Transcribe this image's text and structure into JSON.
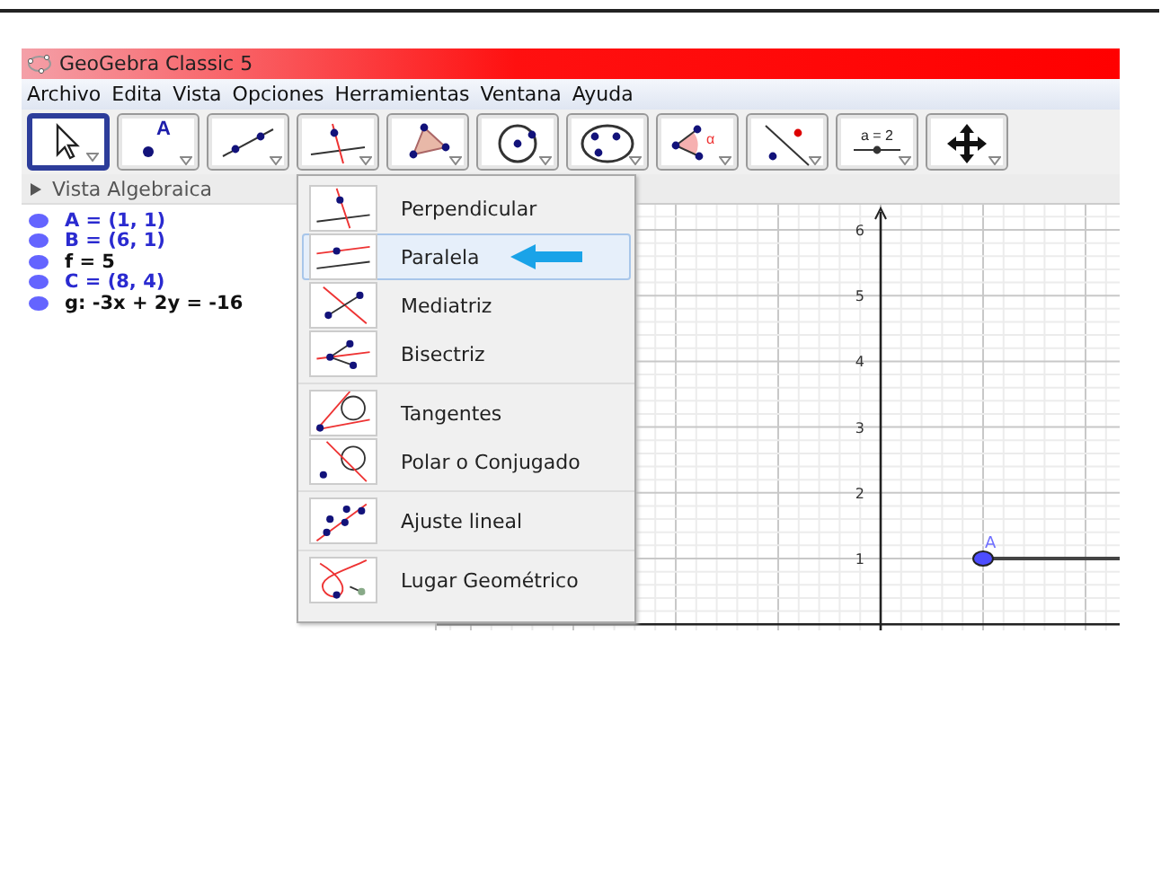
{
  "window": {
    "title": "GeoGebra Classic 5"
  },
  "menu": [
    "Archivo",
    "Edita",
    "Vista",
    "Opciones",
    "Herramientas",
    "Ventana",
    "Ayuda"
  ],
  "toolbar": [
    {
      "kind": "move",
      "selected": true
    },
    {
      "kind": "point",
      "selected": false,
      "caption": "A"
    },
    {
      "kind": "line",
      "selected": false
    },
    {
      "kind": "perpendicular",
      "selected": false
    },
    {
      "kind": "polygon",
      "selected": false
    },
    {
      "kind": "circle",
      "selected": false
    },
    {
      "kind": "conic",
      "selected": false
    },
    {
      "kind": "angle",
      "selected": false,
      "caption": "α"
    },
    {
      "kind": "reflect",
      "selected": false
    },
    {
      "kind": "slider",
      "selected": false,
      "caption": "a = 2"
    },
    {
      "kind": "move_view",
      "selected": false
    }
  ],
  "algebra_view": {
    "title": "Vista Algebraica",
    "items": [
      {
        "text": "A = (1, 1)",
        "kind": "free"
      },
      {
        "text": "B = (6, 1)",
        "kind": "free"
      },
      {
        "text": "f = 5",
        "kind": "dependent"
      },
      {
        "text": "C = (8, 4)",
        "kind": "free"
      },
      {
        "text": "g: -3x + 2y = -16",
        "kind": "dependent"
      }
    ]
  },
  "tool_menu": {
    "groups": [
      {
        "items": [
          {
            "label": "Perpendicular",
            "kind": "perpendicular",
            "selected": false
          },
          {
            "label": "Paralela",
            "kind": "parallel",
            "selected": true
          },
          {
            "label": "Mediatriz",
            "kind": "bisector",
            "selected": false
          },
          {
            "label": "Bisectriz",
            "kind": "angle_bisector",
            "selected": false
          }
        ]
      },
      {
        "items": [
          {
            "label": "Tangentes",
            "kind": "tangents",
            "selected": false
          },
          {
            "label": "Polar o Conjugado",
            "kind": "polar",
            "selected": false
          }
        ]
      },
      {
        "items": [
          {
            "label": "Ajuste lineal",
            "kind": "best_fit",
            "selected": false
          }
        ]
      },
      {
        "items": [
          {
            "label": "Lugar Geométrico",
            "kind": "locus",
            "selected": false
          }
        ]
      }
    ]
  },
  "graphics": {
    "y_ticks": [
      "6",
      "5",
      "4",
      "3",
      "2",
      "1"
    ],
    "point_label": "A"
  }
}
